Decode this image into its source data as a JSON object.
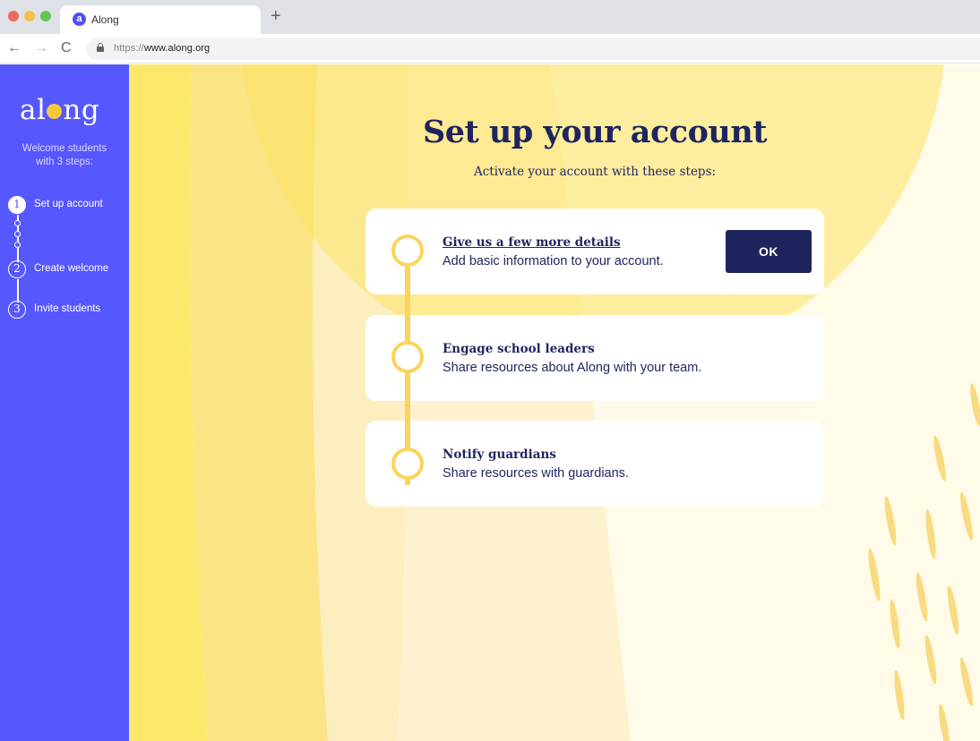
{
  "browser": {
    "tab_title": "Along",
    "tab_favicon_letter": "a",
    "new_tab": "+",
    "back": "←",
    "forward": "→",
    "reload": "C",
    "url_protocol": "https://",
    "url_host": "www.along.org"
  },
  "sidebar": {
    "logo_left": "al",
    "logo_right": "ng",
    "welcome": "Welcome students with 3  steps:",
    "steps": [
      {
        "number": "1",
        "label": "Set up account",
        "active": true
      },
      {
        "number": "2",
        "label": "Create welcome",
        "active": false
      },
      {
        "number": "3",
        "label": "Invite students",
        "active": false
      }
    ]
  },
  "main": {
    "title": "Set up your account",
    "subtitle": "Activate your account with these steps:",
    "tasks": [
      {
        "title": "Give us a few more details",
        "description": "Add basic information to your account.",
        "button": "OK"
      },
      {
        "title": "Engage school leaders",
        "description": "Share resources about Along with your team."
      },
      {
        "title": "Notify guardians",
        "description": "Share resources with guardians."
      }
    ]
  },
  "colors": {
    "sidebar": "#5757ff",
    "navy": "#1e255e",
    "accent_yellow": "#fad45d"
  }
}
